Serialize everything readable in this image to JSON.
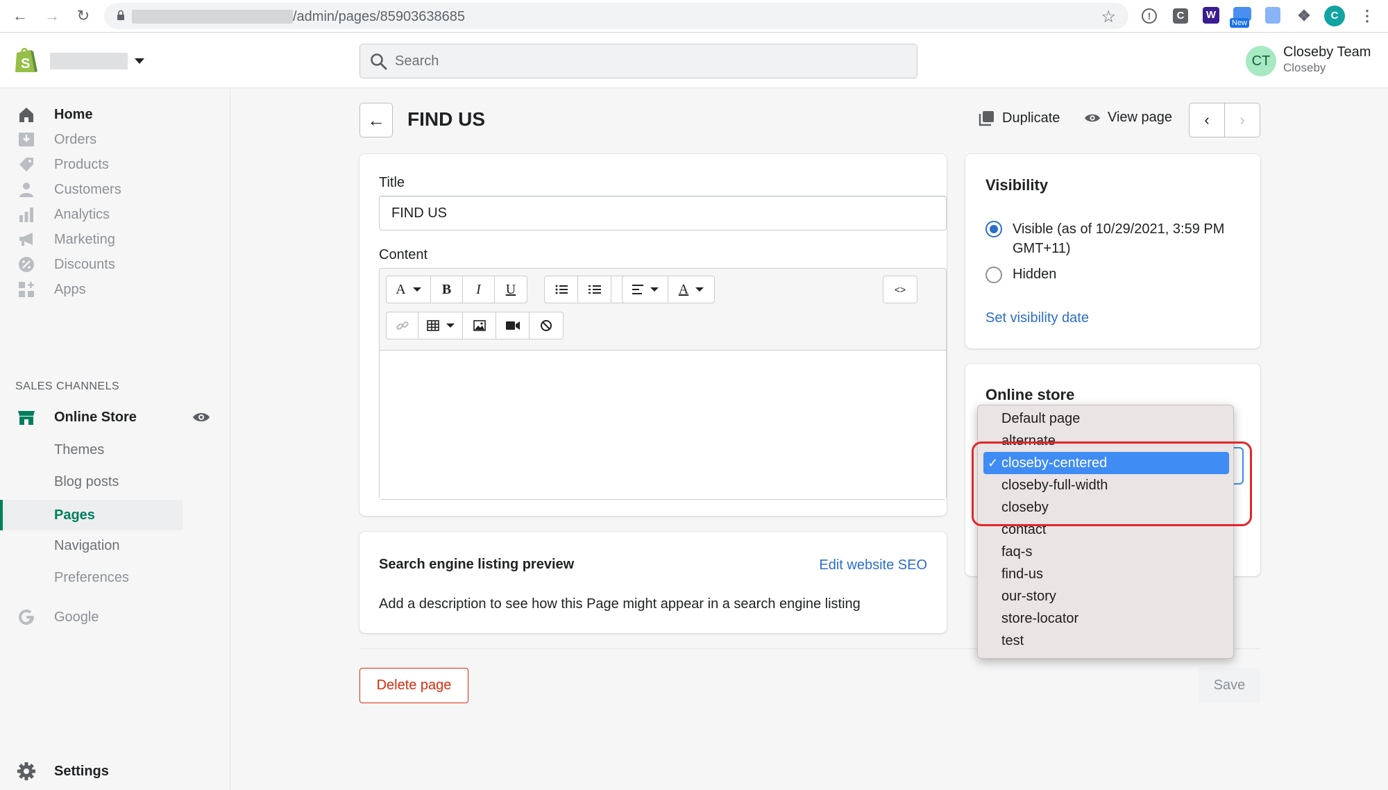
{
  "browser": {
    "url_suffix": "/admin/pages/85903638685",
    "ext_new_badge": "New",
    "profile_initial": "C"
  },
  "topbar": {
    "search_placeholder": "Search",
    "user": {
      "initials": "CT",
      "name": "Closeby Team",
      "store": "Closeby"
    }
  },
  "sidebar": {
    "items": [
      {
        "label": "Home",
        "icon": "home-icon",
        "active": true
      },
      {
        "label": "Orders",
        "icon": "orders-icon"
      },
      {
        "label": "Products",
        "icon": "tag-icon"
      },
      {
        "label": "Customers",
        "icon": "person-icon"
      },
      {
        "label": "Analytics",
        "icon": "bar-chart-icon"
      },
      {
        "label": "Marketing",
        "icon": "megaphone-icon"
      },
      {
        "label": "Discounts",
        "icon": "discount-icon"
      },
      {
        "label": "Apps",
        "icon": "apps-icon"
      }
    ],
    "sales_channels_label": "SALES CHANNELS",
    "online_store": {
      "label": "Online Store",
      "icon": "store-icon"
    },
    "sub_items": [
      {
        "label": "Themes"
      },
      {
        "label": "Blog posts"
      },
      {
        "label": "Pages",
        "selected": true
      },
      {
        "label": "Navigation"
      },
      {
        "label": "Preferences",
        "disabled": true
      }
    ],
    "google": {
      "label": "Google",
      "icon": "google-icon"
    },
    "settings": {
      "label": "Settings",
      "icon": "gear-icon"
    }
  },
  "page": {
    "title": "FIND US",
    "duplicate_label": "Duplicate",
    "view_page_label": "View page"
  },
  "editor_card": {
    "title_label": "Title",
    "title_value": "FIND US",
    "content_label": "Content",
    "toolbar": {
      "font": "A",
      "bold": "B",
      "italic": "I",
      "underline": "U",
      "text_color": "A",
      "html": "<>"
    }
  },
  "seo_card": {
    "heading": "Search engine listing preview",
    "edit_link": "Edit website SEO",
    "description": "Add a description to see how this Page might appear in a search engine listing"
  },
  "visibility_card": {
    "heading": "Visibility",
    "option_visible": "Visible (as of 10/29/2021, 3:59 PM GMT+11)",
    "option_hidden": "Hidden",
    "selected": "visible",
    "set_date_link": "Set visibility date"
  },
  "online_store_card": {
    "heading": "Online store"
  },
  "template_dropdown": {
    "options": [
      "Default page",
      "alternate",
      "closeby-centered",
      "closeby-full-width",
      "closeby",
      "contact",
      "faq-s",
      "find-us",
      "our-story",
      "store-locator",
      "test"
    ],
    "selected": "closeby-centered",
    "check": "✓"
  },
  "footer": {
    "delete_label": "Delete page",
    "save_label": "Save"
  },
  "colors": {
    "accent_green": "#007f5f",
    "link_blue": "#2c6ecb",
    "destructive_red": "#d72c0d",
    "annotation_red": "#e3262a",
    "dropdown_highlight": "#3f8cf4"
  }
}
